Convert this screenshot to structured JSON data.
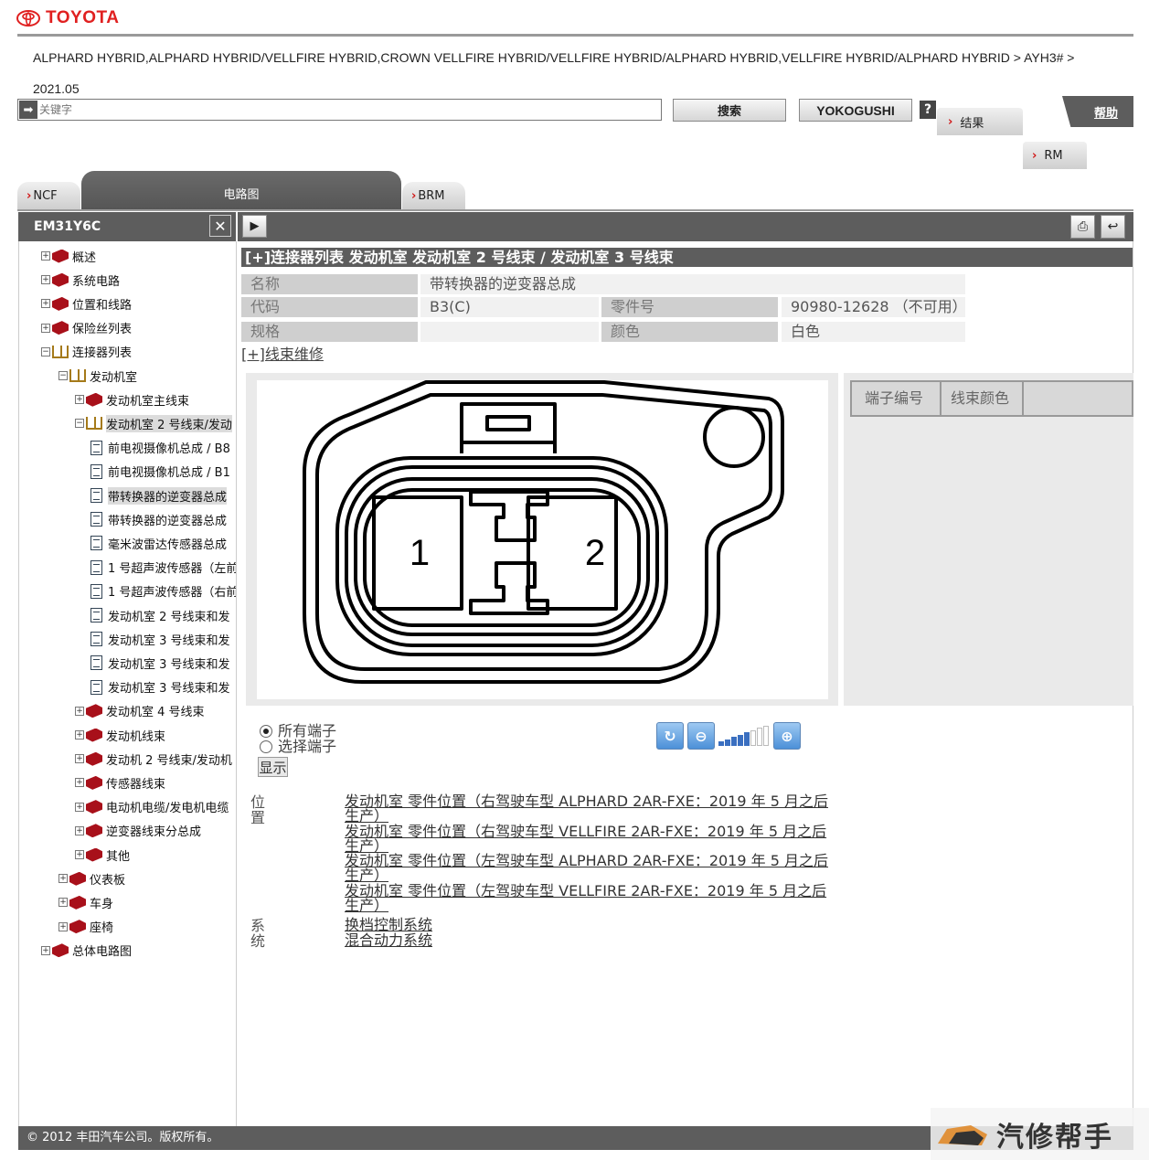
{
  "brand": {
    "name": "TOYOTA",
    "color": "#e02020"
  },
  "breadcrumb": {
    "line1": "ALPHARD HYBRID,ALPHARD HYBRID/VELLFIRE HYBRID,CROWN VELLFIRE HYBRID/VELLFIRE HYBRID/ALPHARD HYBRID,VELLFIRE HYBRID/ALPHARD HYBRID > AYH3# >",
    "line2": "2021.05"
  },
  "search": {
    "placeholder": "关键字",
    "search_label": "搜索",
    "yokogushi_label": "YOKOGUSHI",
    "help_q": "?"
  },
  "top_tabs": {
    "results": "结果",
    "help": "帮助",
    "rm": "RM"
  },
  "main_tabs": {
    "ncf": "NCF",
    "wiring": "电路图",
    "brm": "BRM"
  },
  "left_panel": {
    "header": "EM31Y6C",
    "close": "✕",
    "tree": [
      {
        "label": "概述",
        "level": 0,
        "kind": "closed",
        "toggle": "+"
      },
      {
        "label": "系统电路",
        "level": 0,
        "kind": "closed",
        "toggle": "+"
      },
      {
        "label": "位置和线路",
        "level": 0,
        "kind": "closed",
        "toggle": "+"
      },
      {
        "label": "保险丝列表",
        "level": 0,
        "kind": "closed",
        "toggle": "+"
      },
      {
        "label": "连接器列表",
        "level": 0,
        "kind": "open",
        "toggle": "−"
      },
      {
        "label": "发动机室",
        "level": 1,
        "kind": "open",
        "toggle": "−"
      },
      {
        "label": "发动机室主线束",
        "level": 2,
        "kind": "closed",
        "toggle": "+"
      },
      {
        "label": "发动机室 2 号线束/发动",
        "level": 2,
        "kind": "open",
        "toggle": "−",
        "selected": true
      },
      {
        "label": "前电视摄像机总成 / B8",
        "level": 3,
        "kind": "doc"
      },
      {
        "label": "前电视摄像机总成 / B1",
        "level": 3,
        "kind": "doc"
      },
      {
        "label": "带转换器的逆变器总成",
        "level": 3,
        "kind": "doc",
        "selected": true
      },
      {
        "label": "带转换器的逆变器总成",
        "level": 3,
        "kind": "doc"
      },
      {
        "label": "毫米波雷达传感器总成",
        "level": 3,
        "kind": "doc"
      },
      {
        "label": "1 号超声波传感器（左前",
        "level": 3,
        "kind": "doc"
      },
      {
        "label": "1 号超声波传感器（右前",
        "level": 3,
        "kind": "doc"
      },
      {
        "label": "发动机室 2 号线束和发",
        "level": 3,
        "kind": "doc"
      },
      {
        "label": "发动机室 3 号线束和发",
        "level": 3,
        "kind": "doc"
      },
      {
        "label": "发动机室 3 号线束和发",
        "level": 3,
        "kind": "doc"
      },
      {
        "label": "发动机室 3 号线束和发",
        "level": 3,
        "kind": "doc"
      },
      {
        "label": "发动机室 4 号线束",
        "level": 2,
        "kind": "closed",
        "toggle": "+"
      },
      {
        "label": "发动机线束",
        "level": 2,
        "kind": "closed",
        "toggle": "+"
      },
      {
        "label": "发动机 2 号线束/发动机",
        "level": 2,
        "kind": "closed",
        "toggle": "+"
      },
      {
        "label": "传感器线束",
        "level": 2,
        "kind": "closed",
        "toggle": "+"
      },
      {
        "label": "电动机电缆/发电机电缆",
        "level": 2,
        "kind": "closed",
        "toggle": "+"
      },
      {
        "label": "逆变器线束分总成",
        "level": 2,
        "kind": "closed",
        "toggle": "+"
      },
      {
        "label": "其他",
        "level": 2,
        "kind": "closed",
        "toggle": "+"
      },
      {
        "label": "仪表板",
        "level": 1,
        "kind": "closed",
        "toggle": "+"
      },
      {
        "label": "车身",
        "level": 1,
        "kind": "closed",
        "toggle": "+"
      },
      {
        "label": "座椅",
        "level": 1,
        "kind": "closed",
        "toggle": "+"
      },
      {
        "label": "总体电路图",
        "level": 0,
        "kind": "closed",
        "toggle": "+"
      }
    ]
  },
  "connector": {
    "title": "[+]连接器列表  发动机室  发动机室 2 号线束 / 发动机室 3 号线束",
    "name_label": "名称",
    "name_value": "带转换器的逆变器总成",
    "code_label": "代码",
    "code_value": "B3(C)",
    "part_label": "零件号",
    "part_value": "90980-12628 （不可用）",
    "spec_label": "规格",
    "spec_value": "",
    "color_label": "颜色",
    "color_value": "白色",
    "wire_repair": "[+]线束维修",
    "pins": [
      "1",
      "2"
    ]
  },
  "terminal_table": {
    "headers": [
      "端子编号",
      "线束颜色"
    ]
  },
  "options": {
    "all_terminals": "所有端子",
    "selected_terminals": "选择端子",
    "show": "显示",
    "zoom_level": 5,
    "zoom_max": 8
  },
  "position_section": {
    "label": "位置",
    "links": [
      "发动机室  零件位置（右驾驶车型 ALPHARD 2AR-FXE：2019 年 5 月之后生产）",
      "发动机室  零件位置（右驾驶车型 VELLFIRE 2AR-FXE：2019 年 5 月之后生产）",
      "发动机室  零件位置（左驾驶车型 ALPHARD 2AR-FXE：2019 年 5 月之后生产）",
      "发动机室  零件位置（左驾驶车型 VELLFIRE 2AR-FXE：2019 年 5 月之后生产）"
    ]
  },
  "system_section": {
    "label": "系统",
    "links": [
      "换档控制系统",
      "混合动力系统"
    ]
  },
  "footer": {
    "copyright": "© 2012 丰田汽车公司。版权所有。"
  },
  "watermark": {
    "text": "汽修帮手"
  }
}
